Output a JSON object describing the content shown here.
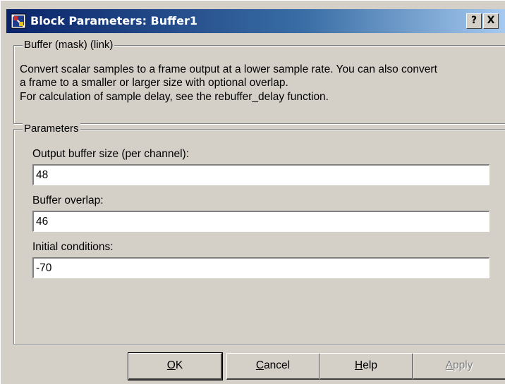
{
  "window": {
    "title": "Block Parameters: Buffer1",
    "help_button": "?",
    "close_button": "X",
    "accent_color": "#0a246a"
  },
  "description_group": {
    "legend": "Buffer (mask) (link)",
    "lines": [
      "Convert scalar samples to a frame output at a lower sample rate.  You can also convert",
      "a frame to a smaller or larger size with optional overlap.",
      "For calculation of sample delay, see the rebuffer_delay function."
    ]
  },
  "parameters_group": {
    "legend": "Parameters",
    "fields": [
      {
        "label": "Output buffer size (per channel):",
        "value": "48"
      },
      {
        "label": "Buffer overlap:",
        "value": "46"
      },
      {
        "label": "Initial conditions:",
        "value": "-70"
      }
    ]
  },
  "buttons": {
    "ok": {
      "mnemonic": "O",
      "rest": "K"
    },
    "cancel": {
      "mnemonic": "C",
      "rest": "ancel"
    },
    "help": {
      "mnemonic": "H",
      "rest": "elp"
    },
    "apply": {
      "mnemonic": "A",
      "rest": "pply",
      "enabled": false
    }
  }
}
